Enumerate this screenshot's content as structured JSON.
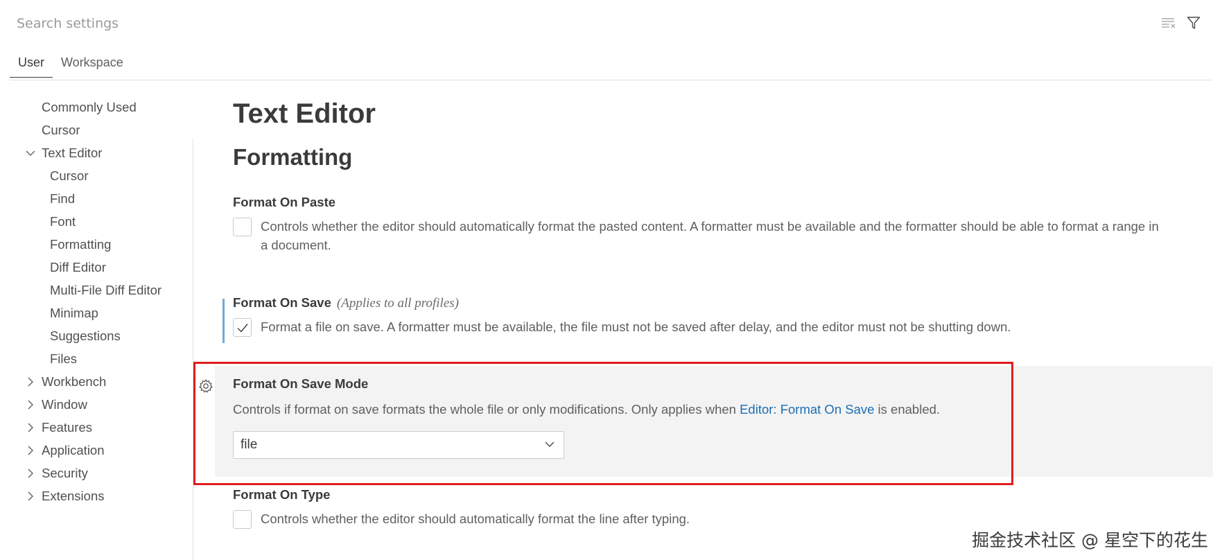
{
  "search": {
    "placeholder": "Search settings"
  },
  "top_icons": [
    "clear-filter-icon",
    "filter-icon"
  ],
  "tabs": [
    {
      "label": "User",
      "active": true
    },
    {
      "label": "Workspace",
      "active": false
    }
  ],
  "toc": [
    {
      "label": "Commonly Used"
    },
    {
      "label": "Cursor"
    },
    {
      "label": "Text Editor",
      "expanded": true
    },
    {
      "label": "Cursor"
    },
    {
      "label": "Find"
    },
    {
      "label": "Font"
    },
    {
      "label": "Formatting"
    },
    {
      "label": "Diff Editor"
    },
    {
      "label": "Multi-File Diff Editor"
    },
    {
      "label": "Minimap"
    },
    {
      "label": "Suggestions"
    },
    {
      "label": "Files"
    },
    {
      "label": "Workbench",
      "expanded": false
    },
    {
      "label": "Window",
      "expanded": false
    },
    {
      "label": "Features",
      "expanded": false
    },
    {
      "label": "Application",
      "expanded": false
    },
    {
      "label": "Security",
      "expanded": false
    },
    {
      "label": "Extensions",
      "expanded": false
    }
  ],
  "main": {
    "heading": "Text Editor",
    "subheading": "Formatting",
    "settings": [
      {
        "title": "Format On Paste",
        "checked": false,
        "description": "Controls whether the editor should automatically format the pasted content. A formatter must be available and the formatter should be able to format a range in a document."
      },
      {
        "title": "Format On Save",
        "tag": "(Applies to all profiles)",
        "checked": true,
        "description": "Format a file on save. A formatter must be available, the file must not be saved after delay, and the editor must not be shutting down."
      },
      {
        "title": "Format On Save Mode",
        "description_before": "Controls if format on save formats the whole file or only modifications. Only applies when ",
        "description_link": "Editor: Format On Save",
        "description_after": " is enabled.",
        "selected_value": "file"
      },
      {
        "title": "Format On Type",
        "checked": false,
        "description": "Controls whether the editor should automatically format the line after typing."
      }
    ]
  },
  "watermark": "掘金技术社区 @ 星空下的花生",
  "colors": {
    "link": "#1a6eb5",
    "highlight_box": "#e01b1b",
    "focus_bar": "#6fa8d8",
    "highlight_bg": "#f3f3f3"
  }
}
